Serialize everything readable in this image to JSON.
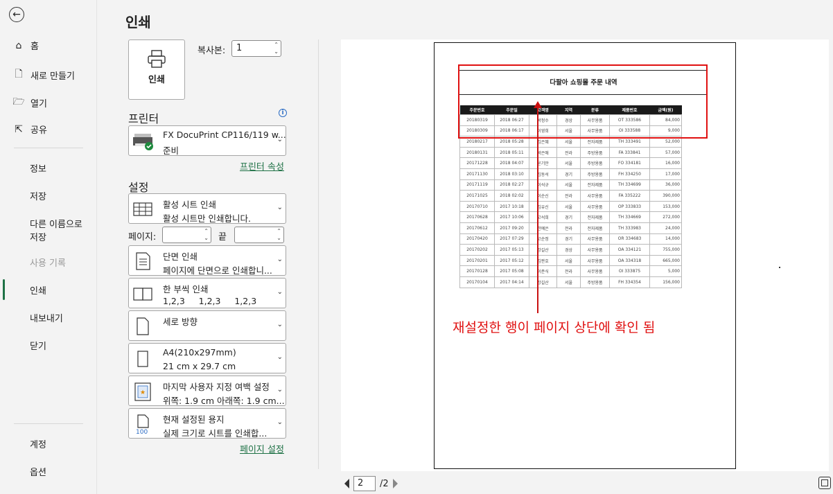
{
  "nav": {
    "items": [
      {
        "label": "홈",
        "icon": "home-icon"
      },
      {
        "label": "새로 만들기",
        "icon": "new-file-icon"
      },
      {
        "label": "열기",
        "icon": "folder-open-icon"
      },
      {
        "label": "공유",
        "icon": "share-icon"
      }
    ],
    "info": "정보",
    "save": "저장",
    "save_as_line1": "다른 이름으로",
    "save_as_line2": "저장",
    "history": "사용 기록",
    "print": "인쇄",
    "export": "내보내기",
    "close": "닫기",
    "account": "계정",
    "options": "옵션"
  },
  "title": "인쇄",
  "print_button": "인쇄",
  "copies": {
    "label": "복사본:",
    "value": "1"
  },
  "printer": {
    "heading": "프린터",
    "name": "FX DocuPrint CP116/119 w...",
    "status": "준비",
    "properties_link": "프린터 속성"
  },
  "settings": {
    "heading": "설정",
    "items": [
      {
        "title": "활성 시트 인쇄",
        "sub": "활성 시트만 인쇄합니다.",
        "icon": "sheet-grid-icon"
      },
      {
        "title": "단면 인쇄",
        "sub": "페이지에 단면으로 인쇄합니...",
        "icon": "one-sided-icon"
      },
      {
        "title": "한 부씩 인쇄",
        "sub": "1,2,3     1,2,3     1,2,3",
        "icon": "collated-icon"
      },
      {
        "title": "세로 방향",
        "sub": "",
        "icon": "portrait-icon"
      },
      {
        "title": "A4(210x297mm)",
        "sub": "21 cm x 29.7 cm",
        "icon": "paper-size-icon"
      },
      {
        "title": "마지막 사용자 지정 여백 설정",
        "sub": "위쪽: 1.9 cm 아래쪽: 1.9 cm...",
        "icon": "margins-icon"
      },
      {
        "title": "현재 설정된 용지",
        "sub": "실제 크기로 시트를 인쇄합...",
        "icon": "scaling-icon",
        "icon_text": "100"
      }
    ],
    "pages_label": "페이지:",
    "end_label": "끝",
    "page_setup_link": "페이지 설정"
  },
  "preview": {
    "doc_title": "다팔아 쇼핑몰 주문 내역",
    "columns": [
      "주문번호",
      "주문일",
      "고객명",
      "지역",
      "분류",
      "제품번호",
      "금액(원)"
    ],
    "rows": [
      [
        "20180319",
        "2018 06:27",
        "박정수",
        "경상",
        "사무용품",
        "OT 333586",
        "84,000"
      ],
      [
        "20180309",
        "2018 06:17",
        "이영희",
        "서울",
        "사무용품",
        "OI 333588",
        "9,000"
      ],
      [
        "20180217",
        "2018 05:28",
        "김은혜",
        "서울",
        "전자제품",
        "TH 333491",
        "52,000"
      ],
      [
        "20180131",
        "2018 05:11",
        "박은애",
        "전라",
        "주방용품",
        "FA 333841",
        "57,000"
      ],
      [
        "20171228",
        "2018 04:07",
        "윤기만",
        "서울",
        "주방용품",
        "FO 334181",
        "16,000"
      ],
      [
        "20171130",
        "2018 03:10",
        "김동석",
        "경기",
        "주방용품",
        "FH 334250",
        "17,000"
      ],
      [
        "20171119",
        "2018 02:27",
        "이석규",
        "서울",
        "전자제품",
        "TH 334699",
        "36,000"
      ],
      [
        "20171025",
        "2018 02:02",
        "이순신",
        "전라",
        "사무용품",
        "FA 335222",
        "390,000"
      ],
      [
        "20170710",
        "2017 10:18",
        "김유신",
        "서울",
        "사무용품",
        "OP 333833",
        "153,000"
      ],
      [
        "20170628",
        "2017 10:06",
        "고석희",
        "경기",
        "전자제품",
        "TH 334669",
        "272,000"
      ],
      [
        "20170612",
        "2017 09:20",
        "한예은",
        "전라",
        "전자제품",
        "TH 333983",
        "24,000"
      ],
      [
        "20170420",
        "2017 07:29",
        "고순정",
        "경기",
        "사무용품",
        "OR 334683",
        "14,000"
      ],
      [
        "20170202",
        "2017 05:13",
        "강길산",
        "경상",
        "사무용품",
        "OA 334121",
        "755,000"
      ],
      [
        "20170201",
        "2017 05:12",
        "김판호",
        "서울",
        "사무용품",
        "OA 334318",
        "665,000"
      ],
      [
        "20170128",
        "2017 05:08",
        "이준식",
        "전라",
        "사무용품",
        "OI 333875",
        "5,000"
      ],
      [
        "20170104",
        "2017 04:14",
        "강길산",
        "서울",
        "주방용품",
        "FH 334354",
        "156,000"
      ]
    ],
    "annotation": "재설정한 행이 페이지 상단에 확인 됨"
  },
  "pager": {
    "current": "2",
    "total": "/2"
  }
}
